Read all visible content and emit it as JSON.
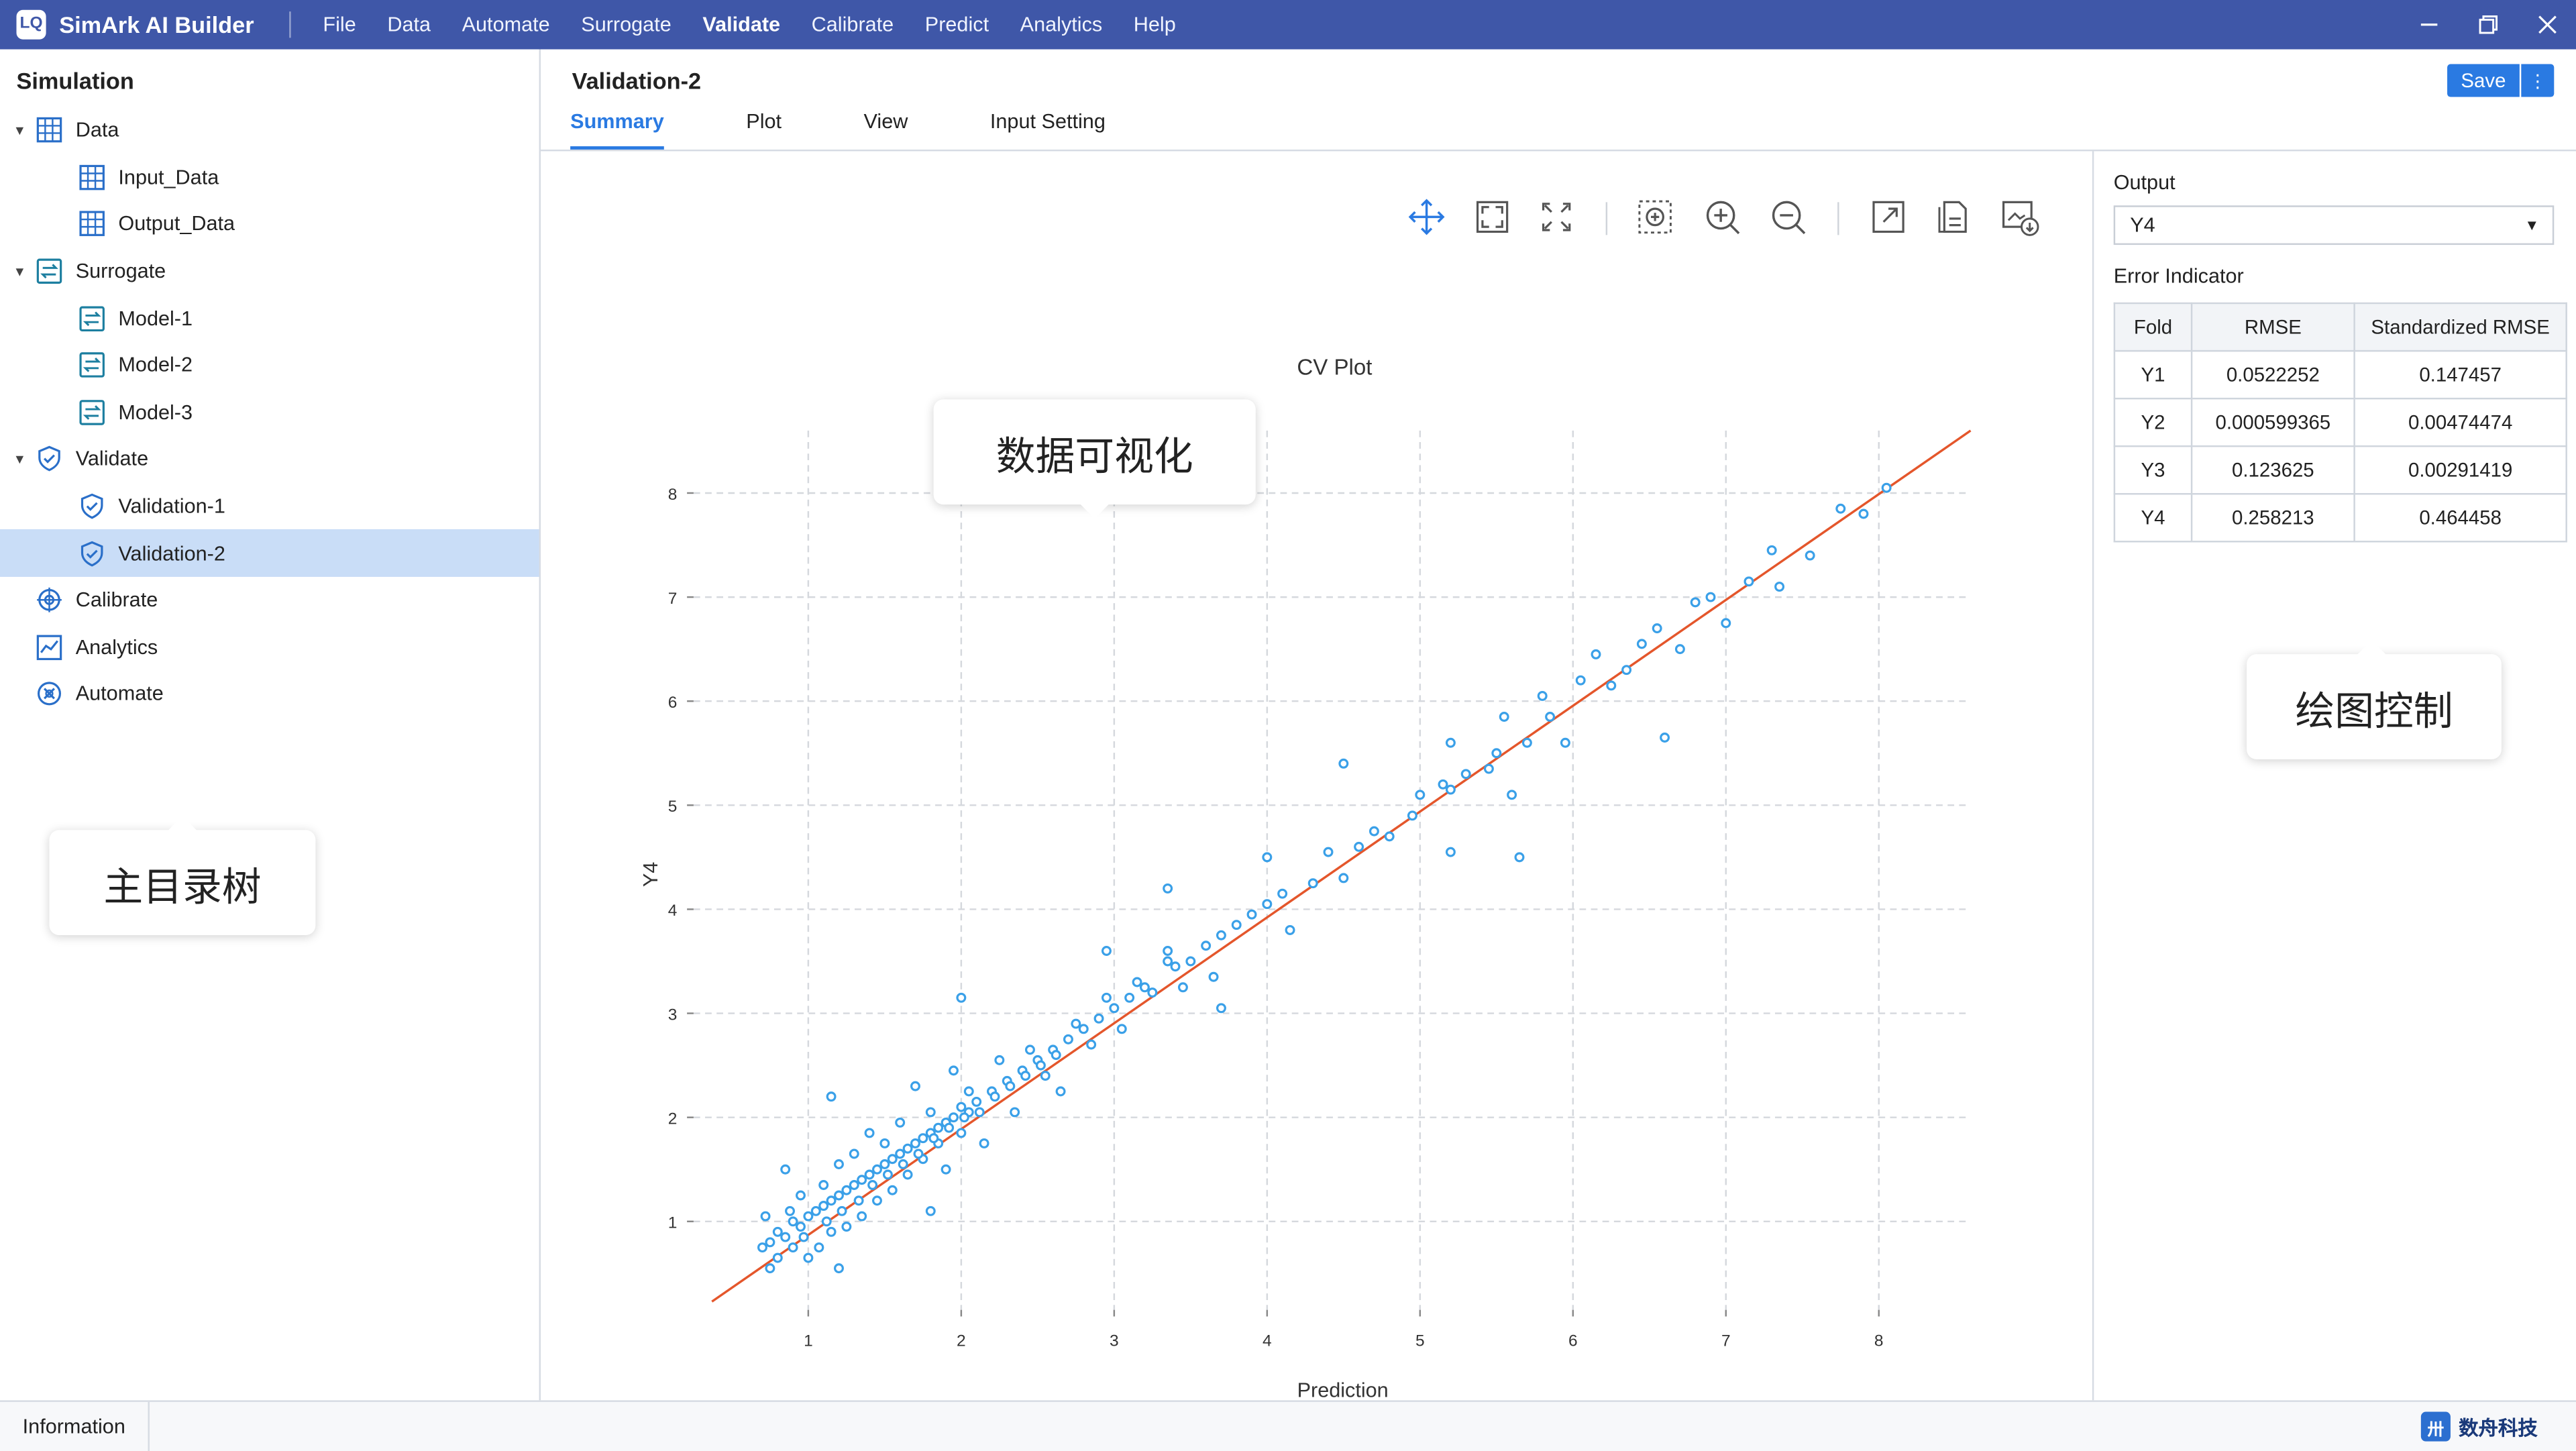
{
  "app": {
    "title": "SimArk AI Builder",
    "logo_text": "LQ"
  },
  "menu": [
    "File",
    "Data",
    "Automate",
    "Surrogate",
    "Validate",
    "Calibrate",
    "Predict",
    "Analytics",
    "Help"
  ],
  "menu_active": "Validate",
  "left": {
    "title": "Simulation",
    "tree": [
      {
        "label": "Data",
        "level": 1,
        "icon": "table-icon",
        "expanded": true
      },
      {
        "label": "Input_Data",
        "level": 2,
        "icon": "table-icon"
      },
      {
        "label": "Output_Data",
        "level": 2,
        "icon": "table-icon"
      },
      {
        "label": "Surrogate",
        "level": 1,
        "icon": "surrogate-icon",
        "expanded": true
      },
      {
        "label": "Model-1",
        "level": 2,
        "icon": "surrogate-icon"
      },
      {
        "label": "Model-2",
        "level": 2,
        "icon": "surrogate-icon"
      },
      {
        "label": "Model-3",
        "level": 2,
        "icon": "surrogate-icon"
      },
      {
        "label": "Validate",
        "level": 1,
        "icon": "shield-icon",
        "expanded": true
      },
      {
        "label": "Validation-1",
        "level": 2,
        "icon": "shield-icon"
      },
      {
        "label": "Validation-2",
        "level": 2,
        "icon": "shield-icon",
        "selected": true
      },
      {
        "label": "Calibrate",
        "level": 0,
        "icon": "target-icon"
      },
      {
        "label": "Analytics",
        "level": 0,
        "icon": "analytics-icon"
      },
      {
        "label": "Automate",
        "level": 0,
        "icon": "automate-icon"
      }
    ]
  },
  "main": {
    "title": "Validation-2",
    "save_label": "Save",
    "more_label": "⋮",
    "tabs": [
      "Summary",
      "Plot",
      "View",
      "Input Setting"
    ],
    "active_tab": "Summary"
  },
  "toolbar_icons": [
    "pan-icon",
    "fit-icon",
    "autoscale-icon",
    "box-zoom-icon",
    "zoom-in-icon",
    "zoom-out-icon",
    "reset-axes-icon",
    "export-icon",
    "download-image-icon"
  ],
  "right": {
    "output_label": "Output",
    "output_value": "Y4",
    "error_label": "Error Indicator",
    "table": {
      "headers": [
        "Fold",
        "RMSE",
        "Standardized RMSE"
      ],
      "rows": [
        [
          "Y1",
          "0.0522252",
          "0.147457"
        ],
        [
          "Y2",
          "0.000599365",
          "0.00474474"
        ],
        [
          "Y3",
          "0.123625",
          "0.00291419"
        ],
        [
          "Y4",
          "0.258213",
          "0.464458"
        ]
      ]
    }
  },
  "bottom": {
    "info_tab": "Information",
    "brand": "数舟科技"
  },
  "callouts": {
    "viz": "数据可视化",
    "plot_ctrl": "绘图控制",
    "tree": "主目录树"
  },
  "colors": {
    "brand": "#3f57a8",
    "accent": "#2a7ae2",
    "point": "#3aa0e8",
    "fit_line": "#e4562b",
    "selected": "#c9ddf7"
  },
  "chart_data": {
    "type": "scatter",
    "title": "CV Plot",
    "xlabel": "Prediction",
    "ylabel": "Y4",
    "xlim": [
      0.25,
      8.6
    ],
    "ylim": [
      0.15,
      8.6
    ],
    "xticks": [
      1,
      2,
      3,
      4,
      5,
      6,
      7,
      8
    ],
    "yticks": [
      1,
      2,
      3,
      4,
      5,
      6,
      7,
      8
    ],
    "grid": true,
    "fit_line": [
      [
        0.37,
        0.23
      ],
      [
        8.6,
        8.6
      ]
    ],
    "points": [
      [
        0.7,
        0.75
      ],
      [
        0.75,
        0.8
      ],
      [
        0.8,
        0.9
      ],
      [
        0.85,
        0.85
      ],
      [
        0.9,
        1.0
      ],
      [
        0.95,
        0.95
      ],
      [
        1.0,
        1.05
      ],
      [
        1.05,
        1.1
      ],
      [
        1.1,
        1.15
      ],
      [
        1.15,
        1.2
      ],
      [
        1.2,
        1.25
      ],
      [
        1.25,
        1.3
      ],
      [
        1.3,
        1.35
      ],
      [
        1.35,
        1.4
      ],
      [
        1.4,
        1.45
      ],
      [
        1.45,
        1.5
      ],
      [
        1.5,
        1.55
      ],
      [
        1.55,
        1.6
      ],
      [
        1.6,
        1.65
      ],
      [
        1.65,
        1.7
      ],
      [
        1.7,
        1.75
      ],
      [
        1.75,
        1.8
      ],
      [
        1.8,
        1.85
      ],
      [
        1.85,
        1.9
      ],
      [
        1.9,
        1.95
      ],
      [
        1.95,
        2.0
      ],
      [
        2.0,
        2.1
      ],
      [
        2.05,
        2.05
      ],
      [
        2.1,
        2.15
      ],
      [
        2.2,
        2.25
      ],
      [
        2.3,
        2.35
      ],
      [
        2.4,
        2.45
      ],
      [
        2.5,
        2.55
      ],
      [
        2.6,
        2.65
      ],
      [
        2.7,
        2.75
      ],
      [
        2.8,
        2.85
      ],
      [
        2.9,
        2.95
      ],
      [
        3.0,
        3.05
      ],
      [
        3.1,
        3.15
      ],
      [
        3.2,
        3.25
      ],
      [
        0.72,
        1.05
      ],
      [
        0.8,
        0.65
      ],
      [
        0.9,
        0.75
      ],
      [
        0.85,
        1.5
      ],
      [
        0.95,
        1.25
      ],
      [
        1.0,
        0.65
      ],
      [
        1.1,
        1.35
      ],
      [
        1.15,
        0.9
      ],
      [
        1.2,
        1.55
      ],
      [
        1.25,
        0.95
      ],
      [
        1.3,
        1.65
      ],
      [
        1.35,
        1.05
      ],
      [
        1.4,
        1.85
      ],
      [
        1.45,
        1.2
      ],
      [
        1.5,
        1.75
      ],
      [
        1.55,
        1.3
      ],
      [
        1.6,
        1.95
      ],
      [
        1.65,
        1.45
      ],
      [
        1.7,
        2.3
      ],
      [
        1.75,
        1.6
      ],
      [
        1.8,
        2.05
      ],
      [
        1.85,
        1.75
      ],
      [
        1.9,
        1.5
      ],
      [
        1.95,
        2.45
      ],
      [
        2.0,
        1.85
      ],
      [
        2.05,
        2.25
      ],
      [
        2.15,
        1.75
      ],
      [
        2.25,
        2.55
      ],
      [
        2.35,
        2.05
      ],
      [
        2.45,
        2.65
      ],
      [
        2.55,
        2.4
      ],
      [
        2.65,
        2.25
      ],
      [
        2.75,
        2.9
      ],
      [
        2.85,
        2.7
      ],
      [
        2.95,
        3.15
      ],
      [
        3.05,
        2.85
      ],
      [
        3.15,
        3.3
      ],
      [
        3.25,
        3.2
      ],
      [
        3.35,
        3.5
      ],
      [
        3.45,
        3.25
      ],
      [
        3.35,
        3.6
      ],
      [
        3.4,
        3.45
      ],
      [
        3.5,
        3.5
      ],
      [
        3.6,
        3.65
      ],
      [
        3.65,
        3.35
      ],
      [
        3.7,
        3.75
      ],
      [
        3.8,
        3.85
      ],
      [
        3.9,
        3.95
      ],
      [
        4.0,
        4.05
      ],
      [
        4.1,
        4.15
      ],
      [
        1.15,
        2.2
      ],
      [
        2.0,
        3.15
      ],
      [
        2.95,
        3.6
      ],
      [
        3.35,
        4.2
      ],
      [
        3.7,
        3.05
      ],
      [
        1.8,
        1.1
      ],
      [
        1.2,
        0.55
      ],
      [
        4.0,
        4.5
      ],
      [
        4.15,
        3.8
      ],
      [
        4.3,
        4.25
      ],
      [
        4.4,
        4.55
      ],
      [
        4.5,
        4.3
      ],
      [
        4.5,
        5.4
      ],
      [
        4.6,
        4.6
      ],
      [
        4.7,
        4.75
      ],
      [
        4.8,
        4.7
      ],
      [
        4.95,
        4.9
      ],
      [
        5.0,
        5.1
      ],
      [
        5.15,
        5.2
      ],
      [
        5.2,
        5.15
      ],
      [
        5.2,
        5.6
      ],
      [
        5.2,
        4.55
      ],
      [
        5.3,
        5.3
      ],
      [
        5.45,
        5.35
      ],
      [
        5.5,
        5.5
      ],
      [
        5.55,
        5.85
      ],
      [
        5.6,
        5.1
      ],
      [
        5.65,
        4.5
      ],
      [
        5.7,
        5.6
      ],
      [
        5.8,
        6.05
      ],
      [
        5.85,
        5.85
      ],
      [
        5.95,
        5.6
      ],
      [
        6.05,
        6.2
      ],
      [
        6.15,
        6.45
      ],
      [
        6.25,
        6.15
      ],
      [
        6.35,
        6.3
      ],
      [
        6.45,
        6.55
      ],
      [
        6.55,
        6.7
      ],
      [
        6.6,
        5.65
      ],
      [
        6.7,
        6.5
      ],
      [
        6.8,
        6.95
      ],
      [
        6.9,
        7.0
      ],
      [
        7.0,
        6.75
      ],
      [
        7.15,
        7.15
      ],
      [
        7.3,
        7.45
      ],
      [
        7.35,
        7.1
      ],
      [
        7.55,
        7.4
      ],
      [
        7.75,
        7.85
      ],
      [
        7.9,
        7.8
      ],
      [
        8.05,
        8.05
      ],
      [
        0.75,
        0.55
      ],
      [
        0.88,
        1.1
      ],
      [
        0.97,
        0.85
      ],
      [
        1.07,
        0.75
      ],
      [
        1.12,
        1.0
      ],
      [
        1.22,
        1.1
      ],
      [
        1.33,
        1.2
      ],
      [
        1.42,
        1.35
      ],
      [
        1.52,
        1.45
      ],
      [
        1.62,
        1.55
      ],
      [
        1.72,
        1.65
      ],
      [
        1.82,
        1.8
      ],
      [
        1.92,
        1.9
      ],
      [
        2.02,
        2.0
      ],
      [
        2.12,
        2.05
      ],
      [
        2.22,
        2.2
      ],
      [
        2.32,
        2.3
      ],
      [
        2.42,
        2.4
      ],
      [
        2.52,
        2.5
      ],
      [
        2.62,
        2.6
      ]
    ]
  }
}
